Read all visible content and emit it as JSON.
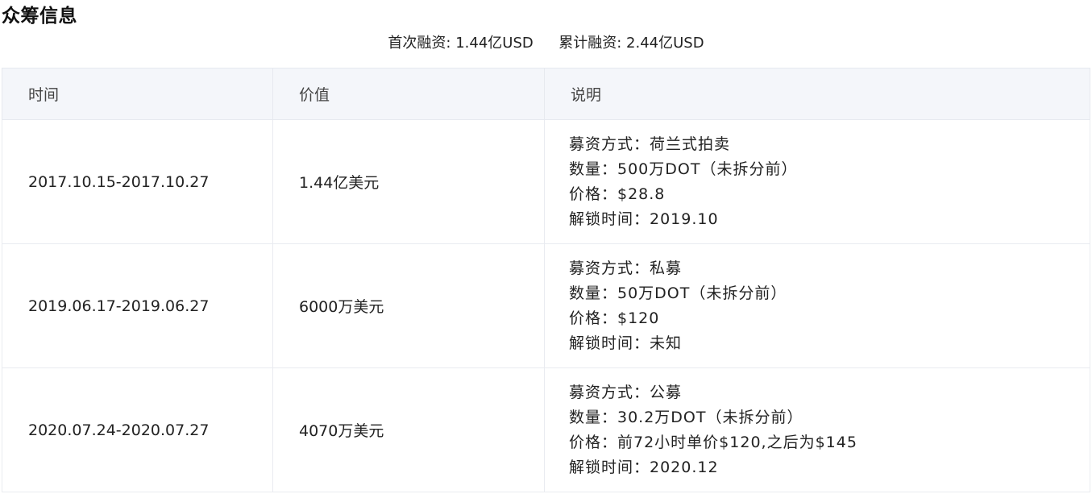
{
  "page": {
    "title": "众筹信息"
  },
  "summary": {
    "first_label": "首次融资:",
    "first_value": "1.44亿USD",
    "total_label": "累计融资:",
    "total_value": "2.44亿USD"
  },
  "table": {
    "headers": [
      "时间",
      "价值",
      "说明"
    ],
    "rows": [
      {
        "time": "2017.10.15-2017.10.27",
        "value": "1.44亿美元",
        "desc": [
          "募资方式：荷兰式拍卖",
          "数量：500万DOT（未拆分前）",
          "价格：$28.8",
          "解锁时间：2019.10"
        ]
      },
      {
        "time": "2019.06.17-2019.06.27",
        "value": "6000万美元",
        "desc": [
          "募资方式：私募",
          "数量：50万DOT（未拆分前）",
          "价格：$120",
          "解锁时间：未知"
        ]
      },
      {
        "time": "2020.07.24-2020.07.27",
        "value": "4070万美元",
        "desc": [
          "募资方式：公募",
          "数量：30.2万DOT（未拆分前）",
          "价格：前72小时单价$120,之后为$145",
          "解锁时间：2020.12"
        ]
      }
    ]
  }
}
